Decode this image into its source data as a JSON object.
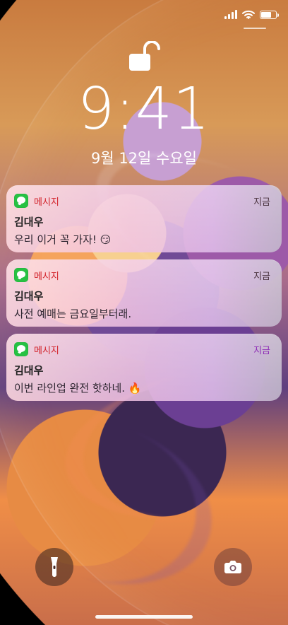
{
  "status": {
    "icons": [
      "cellular-signal-icon",
      "wifi-icon",
      "battery-icon"
    ],
    "battery_fill_percent": 78
  },
  "lock_screen": {
    "lock_icon": "unlocked-padlock-icon",
    "time": "9:41",
    "date": "9월 12일 수요일"
  },
  "notifications": [
    {
      "app_name": "메시지",
      "time_label": "지금",
      "sender": "김대우",
      "message": "우리 이거 꼭 가자! 😏"
    },
    {
      "app_name": "메시지",
      "time_label": "지금",
      "sender": "김대우",
      "message": "사전 예매는 금요일부터래."
    },
    {
      "app_name": "메시지",
      "time_label": "지금",
      "sender": "김대우",
      "message": "이번 라인업 완전 핫하네. 🔥"
    }
  ],
  "quick_actions": {
    "left_icon": "flashlight-icon",
    "right_icon": "camera-icon"
  },
  "colors": {
    "message_app_green": "#27c143",
    "app_name_red": "#d2222a",
    "highlight_time_purple": "#8f2db6",
    "text_dark": "#222222"
  }
}
